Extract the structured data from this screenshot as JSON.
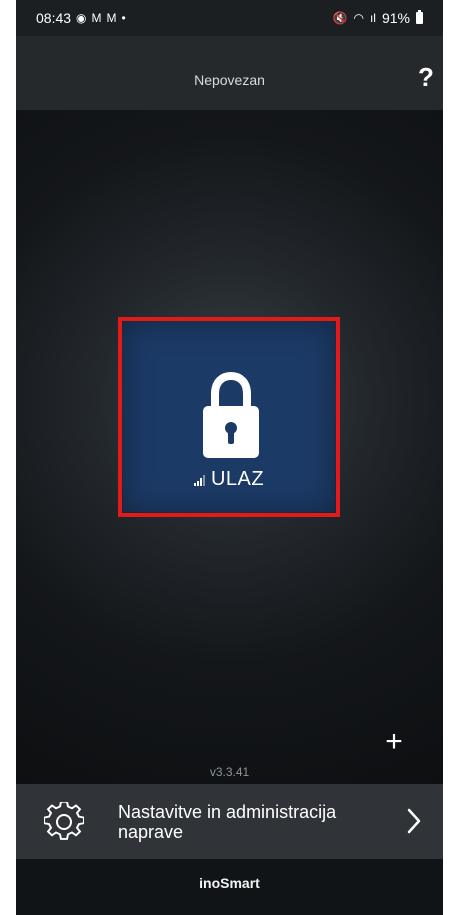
{
  "status_bar": {
    "time": "08:43",
    "left_icons": [
      "messenger-icon",
      "gmail-icon",
      "gmail-icon",
      "dot-icon"
    ],
    "right_icons": [
      "mute-icon",
      "wifi-icon",
      "signal-icon"
    ],
    "battery": "91%"
  },
  "header": {
    "title": "Nepovezan",
    "help_label": "?"
  },
  "door_tile": {
    "label": "ULAZ",
    "icon": "lock-icon",
    "signal": "signal-strength-icon",
    "highlight_color": "#e01b1b",
    "tile_color": "#1c3a66"
  },
  "add_button_label": "+",
  "version": "v3.3.41",
  "settings": {
    "label": "Nastavitve in administracija naprave",
    "icon": "gear-icon",
    "chevron": "chevron-right-icon"
  },
  "footer": {
    "brand": "inoSmart"
  }
}
